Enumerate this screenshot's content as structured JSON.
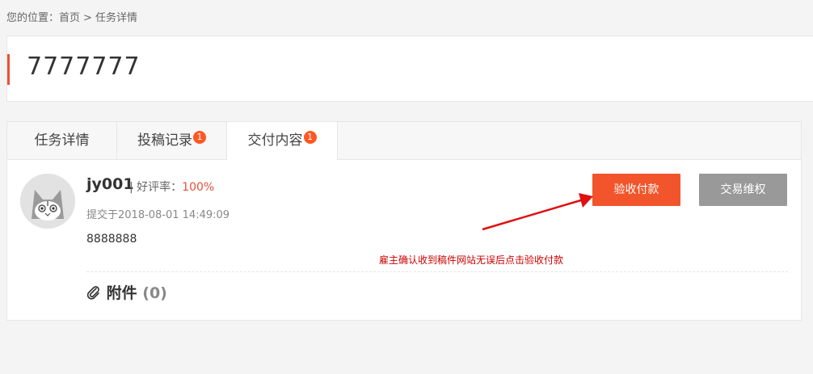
{
  "breadcrumb": {
    "prefix": "您的位置：",
    "home": "首页",
    "separator": ">",
    "current": "任务详情"
  },
  "task": {
    "title": "7777777"
  },
  "tabs": [
    {
      "label": "任务详情",
      "badge": ""
    },
    {
      "label": "投稿记录",
      "badge": "1"
    },
    {
      "label": "交付内容",
      "badge": "1",
      "active": true
    }
  ],
  "delivery": {
    "username": "jy001",
    "rating_label": "| 好评率：",
    "rating_value": "100%",
    "submitted": "提交于2018-08-01 14:49:09",
    "content": "8888888",
    "attachments_label": "附件",
    "attachments_count": "(0)"
  },
  "actions": {
    "accept_label": "验收付款",
    "dispute_label": "交易维权"
  },
  "annotation": {
    "note": "雇主确认收到稿件网站无误后点击验收付款",
    "color": "#cc0000"
  },
  "colors": {
    "accent": "#f2552c",
    "badge": "#ff5722",
    "secondary_button": "#999999"
  }
}
